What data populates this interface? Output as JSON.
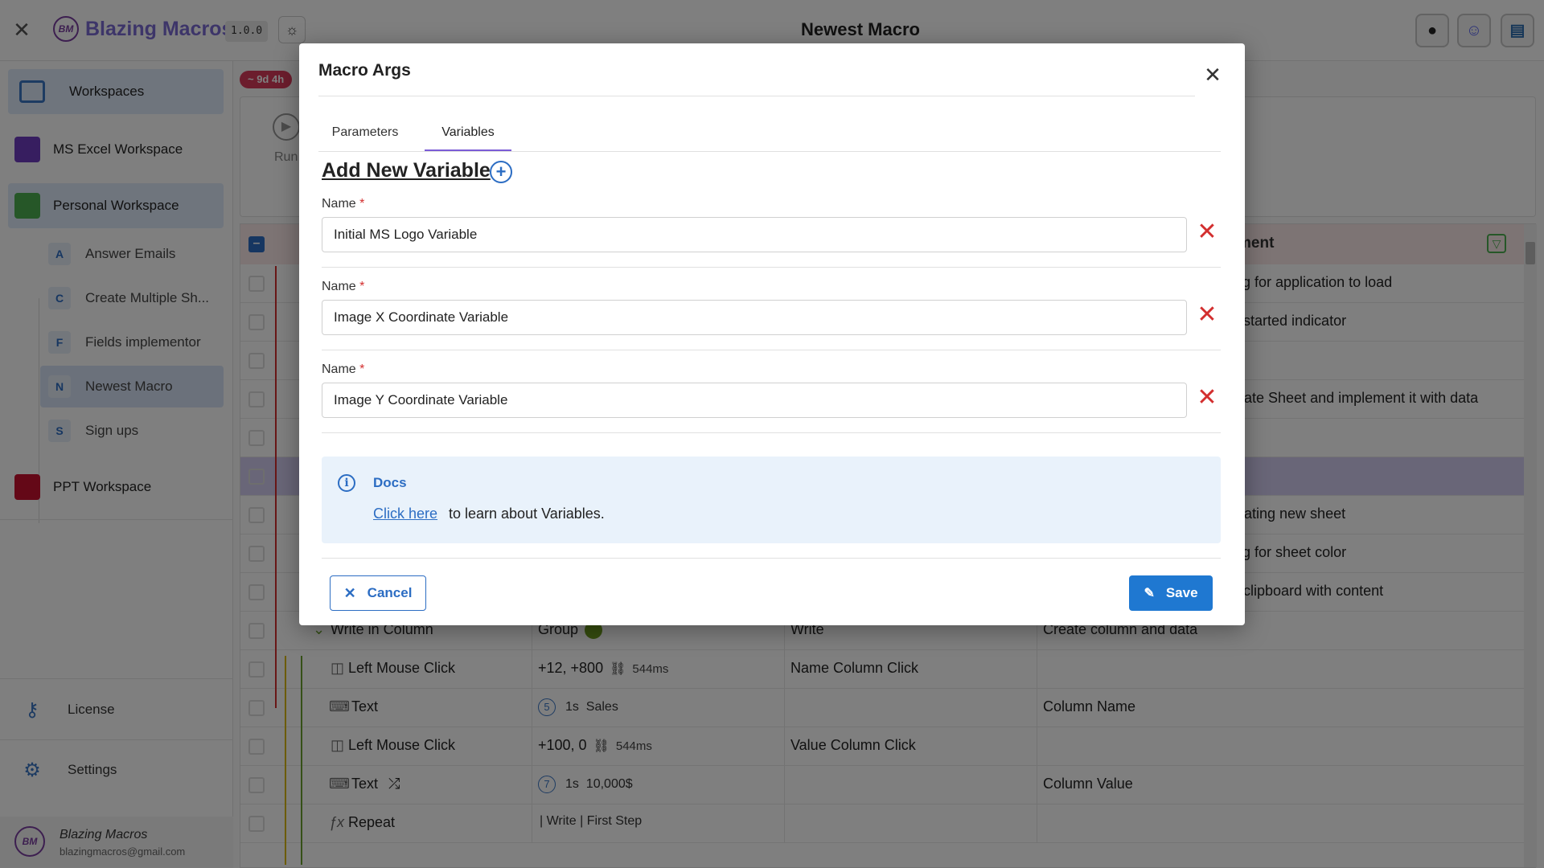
{
  "topbar": {
    "app_name": "Blazing Macros",
    "logo_text": "BM",
    "version": "1.0.0",
    "page_title": "Newest Macro"
  },
  "sidebar": {
    "workspaces_label": "Workspaces",
    "items": [
      {
        "label": "MS Excel Workspace",
        "color": "#6f3cc0"
      },
      {
        "label": "Personal Workspace",
        "color": "#4caf50"
      },
      {
        "label": "PPT Workspace",
        "color": "#c8102e"
      }
    ],
    "macros": [
      {
        "letter": "A",
        "label": "Answer Emails"
      },
      {
        "letter": "C",
        "label": "Create Multiple Sh..."
      },
      {
        "letter": "F",
        "label": "Fields implementor"
      },
      {
        "letter": "N",
        "label": "Newest Macro"
      },
      {
        "letter": "S",
        "label": "Sign ups"
      }
    ],
    "license_label": "License",
    "settings_label": "Settings",
    "user_name": "Blazing Macros",
    "user_email": "blazingmacros@gmail.com"
  },
  "main": {
    "time_badge": "~ 9d 4h",
    "run_label": "Run",
    "header_col": "ment",
    "rows": [
      {
        "desc": "ing for application to load"
      },
      {
        "desc": "o started indicator"
      },
      {
        "desc": ""
      },
      {
        "desc": "erate Sheet and implement it with data"
      },
      {
        "desc": ""
      },
      {
        "desc": ""
      },
      {
        "desc": "erating new sheet"
      },
      {
        "desc": "ing for sheet color"
      },
      {
        "desc": "e clipboard with content"
      }
    ],
    "write_row": {
      "name": "Write in Column",
      "type": "Group",
      "label": "Write",
      "desc": "Create column and data"
    },
    "click_row_1": {
      "name": "Left Mouse Click",
      "value": "+12, +800",
      "ms": "544ms",
      "label": "Name Column Click"
    },
    "text_row_1": {
      "name": "Text",
      "num": "5",
      "time": "1s",
      "value": "Sales",
      "desc": "Column Name"
    },
    "click_row_2": {
      "name": "Left Mouse Click",
      "value": "+100, 0",
      "ms": "544ms",
      "label": "Value Column Click"
    },
    "text_row_2": {
      "name": "Text",
      "num": "7",
      "time": "1s",
      "value": "10,000$",
      "desc": "Column Value"
    },
    "repeat_row": {
      "name": "Repeat",
      "value_a": "Write",
      "value_b": "First Step"
    }
  },
  "modal": {
    "title": "Macro Args",
    "tabs": [
      "Parameters",
      "Variables"
    ],
    "active_tab": "Variables",
    "add_title": "Add New Variable",
    "field_label": "Name",
    "required_mark": "*",
    "variables": [
      "Initial MS Logo Variable",
      "Image X Coordinate Variable",
      "Image Y Coordinate Variable"
    ],
    "docs": {
      "title": "Docs",
      "link": "Click here",
      "text": "to learn about Variables."
    },
    "cancel_label": "Cancel",
    "save_label": "Save"
  },
  "colors": {
    "accent": "#2c6dc3",
    "tab_underline": "#7b5cd6",
    "danger": "#d32f2f",
    "save_bg": "#1f78d1"
  }
}
